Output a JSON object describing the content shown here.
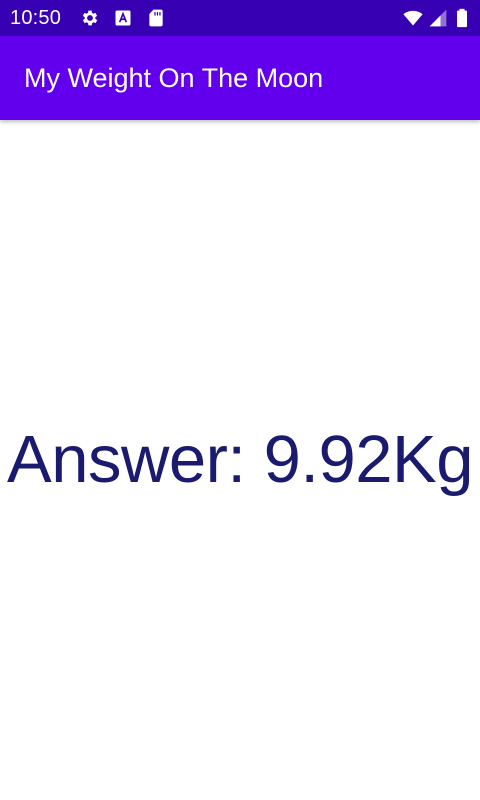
{
  "status_bar": {
    "time": "10:50",
    "background_color": "#3700b3",
    "left_icons": [
      "settings-icon",
      "font-a-icon",
      "sd-card-icon"
    ],
    "right_icons": [
      "wifi-icon",
      "cell-signal-icon",
      "battery-icon"
    ]
  },
  "app_bar": {
    "title": "My Weight On The Moon",
    "background_color": "#6200ee"
  },
  "main": {
    "answer": "Answer: 9.92Kg",
    "answer_color": "#1a1a6e"
  }
}
